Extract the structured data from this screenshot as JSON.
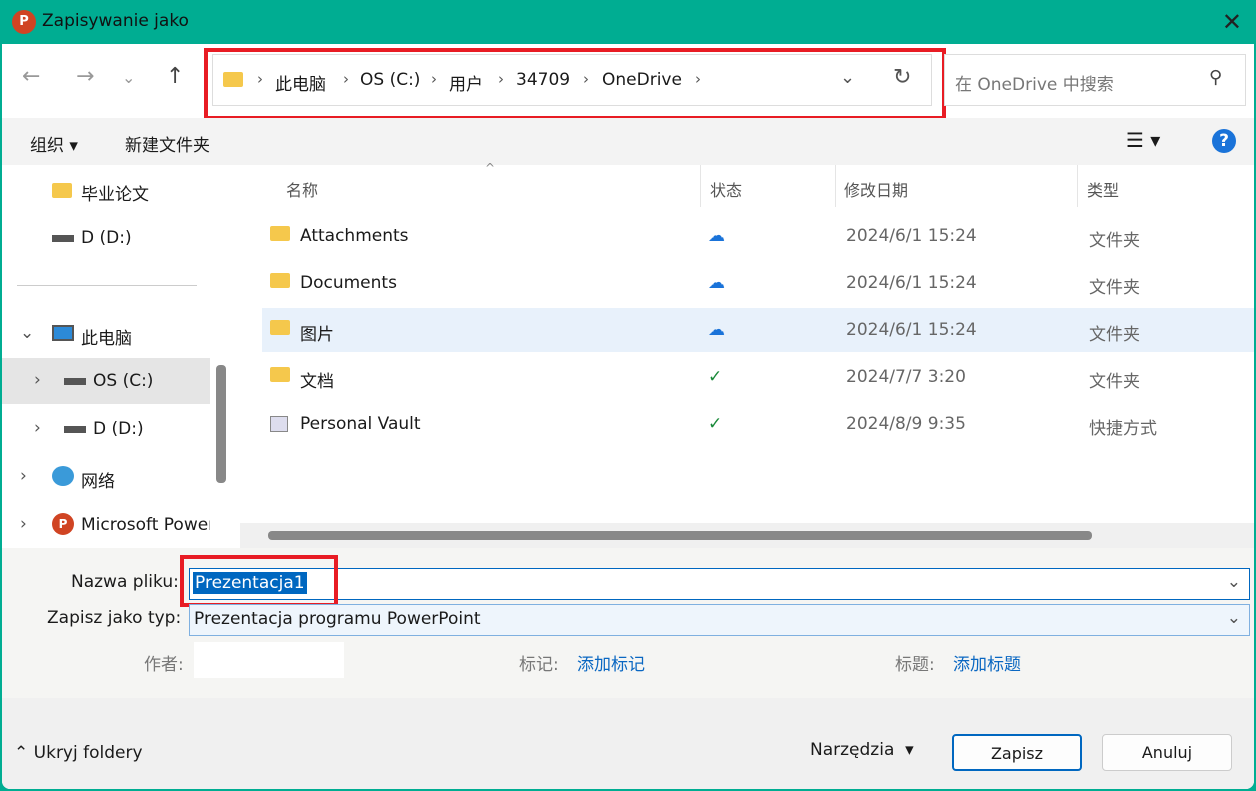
{
  "window": {
    "title": "Zapisywanie jako",
    "app_icon_letter": "P"
  },
  "address": {
    "crumbs": [
      "此电脑",
      "OS (C:)",
      "用户",
      "34709",
      "OneDrive"
    ]
  },
  "search": {
    "placeholder": "在 OneDrive 中搜索"
  },
  "toolbar": {
    "organize": "组织",
    "new_folder": "新建文件夹"
  },
  "sidebar": {
    "items": [
      {
        "label": "毕业论文"
      },
      {
        "label": "D (D:)"
      },
      {
        "label": "此电脑"
      },
      {
        "label": "OS (C:)"
      },
      {
        "label": "D (D:)"
      },
      {
        "label": "网络"
      },
      {
        "label": "Microsoft PowerPoint"
      }
    ]
  },
  "columns": {
    "name": "名称",
    "status": "状态",
    "modified": "修改日期",
    "type": "类型"
  },
  "files": [
    {
      "name": "Attachments",
      "status": "cloud",
      "date": "2024/6/1 15:24",
      "type": "文件夹"
    },
    {
      "name": "Documents",
      "status": "cloud",
      "date": "2024/6/1 15:24",
      "type": "文件夹"
    },
    {
      "name": "图片",
      "status": "cloud",
      "date": "2024/6/1 15:24",
      "type": "文件夹"
    },
    {
      "name": "文档",
      "status": "synced",
      "date": "2024/7/7 3:20",
      "type": "文件夹"
    },
    {
      "name": "Personal Vault",
      "status": "synced",
      "date": "2024/8/9 9:35",
      "type": "快捷方式"
    }
  ],
  "form": {
    "filename_label": "Nazwa pliku:",
    "filename_value": "Prezentacja1",
    "type_label": "Zapisz jako typ:",
    "type_value": "Prezentacja programu PowerPoint",
    "author_label": "作者:",
    "tags_label": "标记:",
    "tags_link": "添加标记",
    "title_label": "标题:",
    "title_link": "添加标题"
  },
  "footer": {
    "hide_folders": "Ukryj foldery",
    "tools": "Narzędzia",
    "save": "Zapisz",
    "cancel": "Anuluj"
  },
  "colors": {
    "titlebar": "#00ad92",
    "highlight": "#e81c24",
    "selection": "#0067c0"
  }
}
